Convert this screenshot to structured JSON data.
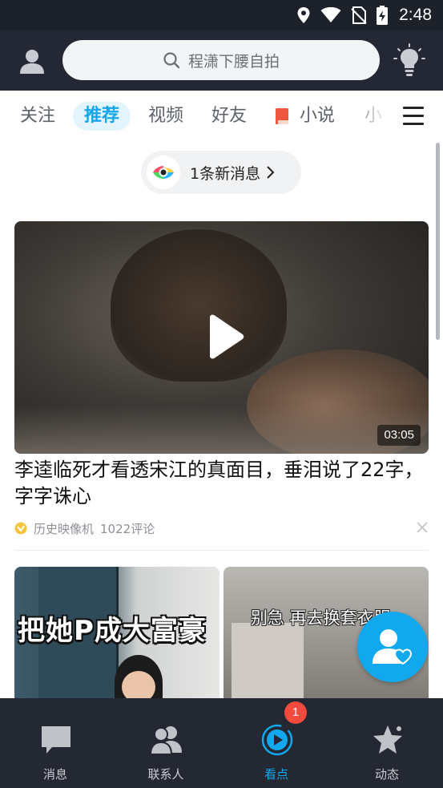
{
  "status_bar": {
    "time": "2:48",
    "icons": [
      "location-icon",
      "wifi-icon",
      "no-sim-icon",
      "battery-charging-icon"
    ]
  },
  "header": {
    "avatar_icon": "user-avatar-icon",
    "search_icon": "search-icon",
    "search_placeholder": "程潇下腰自拍",
    "bulb_icon": "lightbulb-icon"
  },
  "tabs": [
    {
      "label": "关注",
      "active": false
    },
    {
      "label": "推荐",
      "active": true
    },
    {
      "label": "视频",
      "active": false
    },
    {
      "label": "好友",
      "active": false
    },
    {
      "label": "小说",
      "active": false,
      "icon": "book-icon"
    },
    {
      "label": "小",
      "active": false
    }
  ],
  "menu_icon": "hamburger-menu-icon",
  "new_messages": {
    "text": "1条新消息",
    "icon": "eye-logo-icon"
  },
  "video_card": {
    "duration": "03:05",
    "title": "李逵临死才看透宋江的真面目，垂泪说了22字，字字诛心",
    "source": "历史映像机",
    "comments": "1022评论"
  },
  "thumbnails": [
    {
      "caption": "把她P成大富豪"
    },
    {
      "caption": "别急 再去换套衣服"
    }
  ],
  "fab_icon": "friends-heart-icon",
  "bottom_nav": {
    "items": [
      {
        "label": "消息",
        "icon": "chat-bubble-icon",
        "active": false
      },
      {
        "label": "联系人",
        "icon": "contacts-icon",
        "active": false
      },
      {
        "label": "看点",
        "icon": "play-circle-icon",
        "active": true
      },
      {
        "label": "动态",
        "icon": "star-icon",
        "active": false
      }
    ],
    "badge": "1"
  },
  "colors": {
    "accent": "#12a8ee",
    "header_bg": "#232834",
    "badge": "#f24a3d"
  }
}
